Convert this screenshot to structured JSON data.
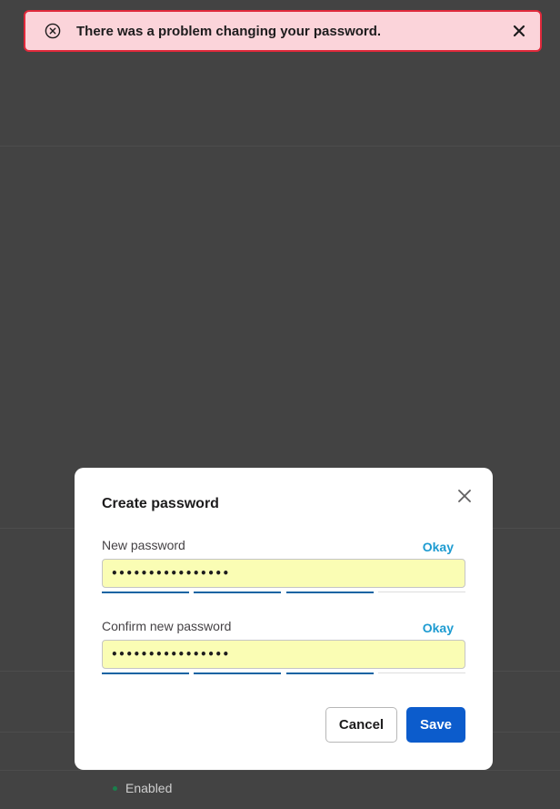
{
  "toast": {
    "message": "There was a problem changing your password.",
    "icon": "error-circle-icon",
    "close_icon": "close-icon",
    "accent_color": "#e0293b"
  },
  "modal": {
    "title": "Create password",
    "close_icon": "close-icon",
    "fields": [
      {
        "label": "New password",
        "strength": "Okay",
        "value": "••••••••••••••••",
        "strength_level": 0.75
      },
      {
        "label": "Confirm new password",
        "strength": "Okay",
        "value": "••••••••••••••••",
        "strength_level": 0.75
      }
    ],
    "cancel_label": "Cancel",
    "save_label": "Save",
    "primary_color": "#0c5ccc"
  },
  "background": {
    "status_text": "Enabled"
  }
}
